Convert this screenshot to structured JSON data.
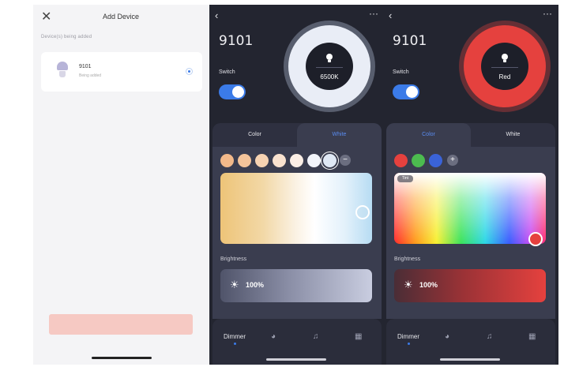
{
  "add_device": {
    "title": "Add Device",
    "section_label": "Device(s) being added",
    "device": {
      "name": "9101",
      "status": "Being added"
    },
    "confirm_label": ""
  },
  "panel_white": {
    "device_name": "9101",
    "switch_label": "Switch",
    "ring_value": "6500K",
    "tabs": [
      "Color",
      "White"
    ],
    "active_tab": "White",
    "swatches": [
      "#f2b98a",
      "#f4c49a",
      "#f7d3b2",
      "#f9e2cf",
      "#fcefe6",
      "#f2f4fa",
      "#dfe8f5"
    ],
    "brightness_label": "Brightness",
    "brightness_value": "100%",
    "nav": {
      "dimmer": "Dimmer"
    },
    "switch_on": true
  },
  "panel_color": {
    "device_name": "9101",
    "switch_label": "Switch",
    "ring_value": "Red",
    "tabs": [
      "Color",
      "White"
    ],
    "active_tab": "Color",
    "swatches": [
      "#e5413e",
      "#4cbb4f",
      "#3a63d8"
    ],
    "picker_badge": "Tint",
    "brightness_label": "Brightness",
    "brightness_value": "100%",
    "nav": {
      "dimmer": "Dimmer"
    },
    "switch_on": true
  },
  "colors": {
    "accent": "#3b7be8",
    "dark_bg": "#232530",
    "confirm": "#f6c9c3",
    "red": "#e5413e"
  }
}
